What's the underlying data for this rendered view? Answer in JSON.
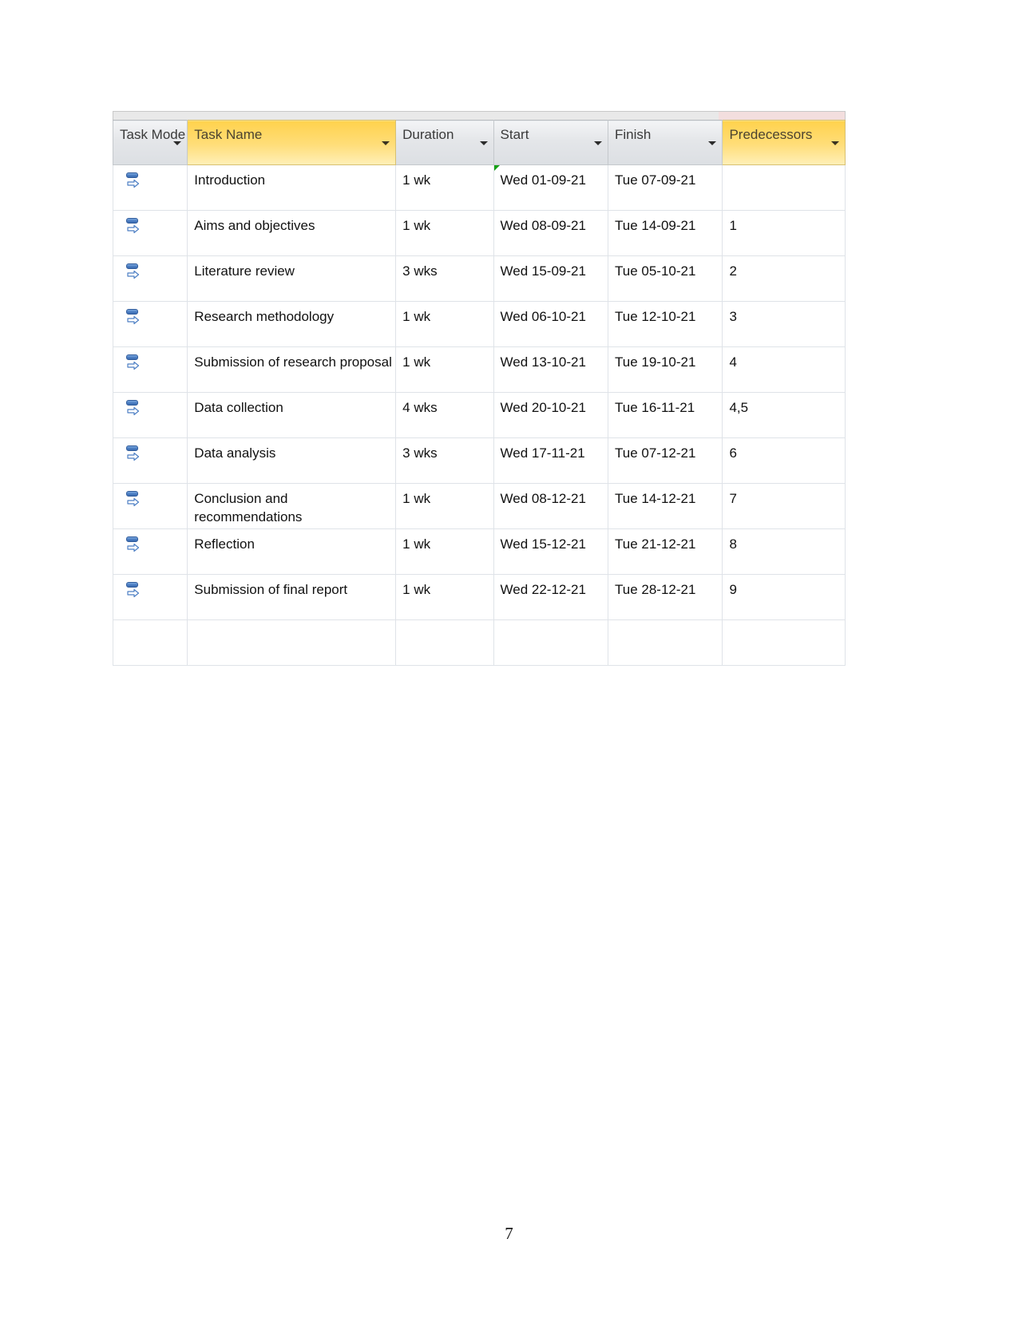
{
  "document": {
    "page_number": "7"
  },
  "project_table": {
    "columns": [
      {
        "key": "task_mode",
        "label": "Task Mode",
        "accent": false,
        "has_dropdown": true
      },
      {
        "key": "task_name",
        "label": "Task Name",
        "accent": true,
        "has_dropdown": true
      },
      {
        "key": "duration",
        "label": "Duration",
        "accent": false,
        "has_dropdown": true
      },
      {
        "key": "start",
        "label": "Start",
        "accent": false,
        "has_dropdown": true
      },
      {
        "key": "finish",
        "label": "Finish",
        "accent": false,
        "has_dropdown": true
      },
      {
        "key": "predecessors",
        "label": "Predecessors",
        "accent": true,
        "has_dropdown": true
      }
    ],
    "column_header_icons": {
      "dropdown": "chevron-down-icon",
      "task_mode_row_icon": "auto-scheduled-icon"
    },
    "colors": {
      "header_accent": "#ffd24d",
      "header_normal": "#e4e6e9",
      "highlight_cell": "#dfeaf7",
      "grid_line": "#dfe3e8",
      "change_marker": "#16a016",
      "task_mode_icon": "#4d7fc4"
    },
    "rows": [
      {
        "task_mode": "auto-scheduled-icon",
        "task_name": "Introduction",
        "duration": "1 wk",
        "start": "Wed 01-09-21",
        "finish": "Tue 07-09-21",
        "predecessors": "",
        "highlight": {
          "duration": false,
          "start": false,
          "finish": false
        },
        "change_marker": true
      },
      {
        "task_mode": "auto-scheduled-icon",
        "task_name": "Aims and objectives",
        "duration": "1 wk",
        "start": "Wed 08-09-21",
        "finish": "Tue 14-09-21",
        "predecessors": "1",
        "highlight": {
          "duration": false,
          "start": false,
          "finish": false
        },
        "change_marker": false
      },
      {
        "task_mode": "auto-scheduled-icon",
        "task_name": "Literature review",
        "duration": "3 wks",
        "start": "Wed 15-09-21",
        "finish": "Tue 05-10-21",
        "predecessors": "2",
        "highlight": {
          "duration": true,
          "start": false,
          "finish": true
        },
        "change_marker": false
      },
      {
        "task_mode": "auto-scheduled-icon",
        "task_name": "Research methodology",
        "duration": "1 wk",
        "start": "Wed 06-10-21",
        "finish": "Tue 12-10-21",
        "predecessors": "3",
        "highlight": {
          "duration": false,
          "start": true,
          "finish": true
        },
        "change_marker": false
      },
      {
        "task_mode": "auto-scheduled-icon",
        "task_name": "Submission of research proposal",
        "duration": "1 wk",
        "start": "Wed 13-10-21",
        "finish": "Tue 19-10-21",
        "predecessors": "4",
        "highlight": {
          "duration": false,
          "start": true,
          "finish": true
        },
        "change_marker": false
      },
      {
        "task_mode": "auto-scheduled-icon",
        "task_name": "Data collection",
        "duration": "4 wks",
        "start": "Wed 20-10-21",
        "finish": "Tue 16-11-21",
        "predecessors": "4,5",
        "highlight": {
          "duration": false,
          "start": true,
          "finish": true
        },
        "change_marker": false
      },
      {
        "task_mode": "auto-scheduled-icon",
        "task_name": "Data analysis",
        "duration": "3 wks",
        "start": "Wed 17-11-21",
        "finish": "Tue 07-12-21",
        "predecessors": "6",
        "highlight": {
          "duration": false,
          "start": true,
          "finish": true
        },
        "change_marker": false
      },
      {
        "task_mode": "auto-scheduled-icon",
        "task_name": "Conclusion and recommendations",
        "duration": "1 wk",
        "start": "Wed 08-12-21",
        "finish": "Tue 14-12-21",
        "predecessors": "7",
        "highlight": {
          "duration": false,
          "start": true,
          "finish": true
        },
        "change_marker": false
      },
      {
        "task_mode": "auto-scheduled-icon",
        "task_name": "Reflection",
        "duration": "1 wk",
        "start": "Wed 15-12-21",
        "finish": "Tue 21-12-21",
        "predecessors": "8",
        "highlight": {
          "duration": false,
          "start": true,
          "finish": true
        },
        "change_marker": false
      },
      {
        "task_mode": "auto-scheduled-icon",
        "task_name": "Submission of final report",
        "duration": "1 wk",
        "start": "Wed 22-12-21",
        "finish": "Tue 28-12-21",
        "predecessors": "9",
        "highlight": {
          "duration": false,
          "start": true,
          "finish": true
        },
        "change_marker": false
      }
    ]
  }
}
